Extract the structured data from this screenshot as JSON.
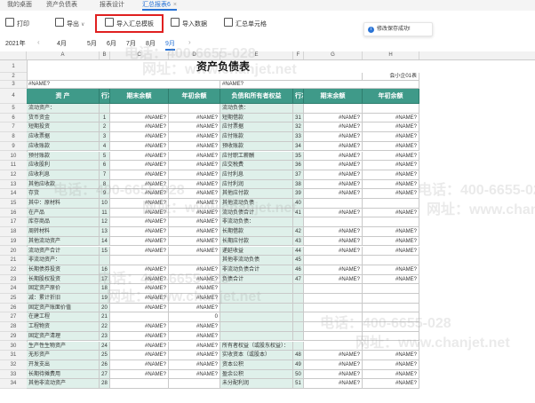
{
  "tabs": [
    {
      "label": "我的桌面"
    },
    {
      "label": "资产负债表"
    },
    {
      "label": "报表设计"
    },
    {
      "label": "汇总报表6",
      "active": true
    }
  ],
  "toolbar": {
    "print": "打印",
    "export": "导出",
    "import_template": "导入汇总模板",
    "import_data": "导入数据",
    "summary_cells": "汇总单元格"
  },
  "toast": "修改保存成功!",
  "period": {
    "year": "2021年",
    "months": [
      "4月",
      "5月",
      "6月",
      "7月",
      "8月",
      "9月"
    ],
    "active_month": "9月"
  },
  "columns": [
    "A",
    "B",
    "C",
    "D",
    "E",
    "F",
    "G",
    "H"
  ],
  "sheet": {
    "title": "资产负债表",
    "form_no": "会小企01表",
    "name_err": "#NAME?",
    "headers_left": [
      "资 产",
      "行次",
      "期末余额",
      "年初余额"
    ],
    "headers_right": [
      "负债和所有者权益",
      "行次",
      "期末余额",
      "年初余额"
    ],
    "err": "#NAME?",
    "zero": "0",
    "rows": [
      {
        "r": 5,
        "a": "流动资产：",
        "b": "",
        "cv": false,
        "e": "流动负债：",
        "f": "",
        "gv": false
      },
      {
        "r": 6,
        "a": "  货币资金",
        "b": "1",
        "cv": true,
        "e": "  短期借款",
        "f": "31",
        "gv": true
      },
      {
        "r": 7,
        "a": "  短期投资",
        "b": "2",
        "cv": true,
        "e": "  应付票据",
        "f": "32",
        "gv": true
      },
      {
        "r": 8,
        "a": "  应收票据",
        "b": "3",
        "cv": true,
        "e": "  应付账款",
        "f": "33",
        "gv": true
      },
      {
        "r": 9,
        "a": "  应收账款",
        "b": "4",
        "cv": true,
        "e": "  预收账款",
        "f": "34",
        "gv": true
      },
      {
        "r": 10,
        "a": "  预付账款",
        "b": "5",
        "cv": true,
        "e": "  应付职工薪酬",
        "f": "35",
        "gv": true
      },
      {
        "r": 11,
        "a": "  应收股利",
        "b": "6",
        "cv": true,
        "e": "  应交税费",
        "f": "36",
        "gv": true
      },
      {
        "r": 12,
        "a": "  应收利息",
        "b": "7",
        "cv": true,
        "e": "  应付利息",
        "f": "37",
        "gv": true
      },
      {
        "r": 13,
        "a": "  其他应收款",
        "b": "8",
        "cv": true,
        "e": "  应付利润",
        "f": "38",
        "gv": true
      },
      {
        "r": 14,
        "a": "  存货",
        "b": "9",
        "cv": true,
        "e": "  其他应付款",
        "f": "39",
        "gv": true
      },
      {
        "r": 15,
        "a": "    其中：原材料",
        "b": "10",
        "cv": true,
        "e": "  其他流动负债",
        "f": "40",
        "gv": false
      },
      {
        "r": 16,
        "a": "          在产品",
        "b": "11",
        "cv": true,
        "e": "    流动负债合计",
        "f": "41",
        "gv": true
      },
      {
        "r": 17,
        "a": "          库存商品",
        "b": "12",
        "cv": true,
        "e": "非流动负债：",
        "f": "",
        "gv": false
      },
      {
        "r": 18,
        "a": "          周转材料",
        "b": "13",
        "cv": true,
        "e": "  长期借款",
        "f": "42",
        "gv": true
      },
      {
        "r": 19,
        "a": "  其他流动资产",
        "b": "14",
        "cv": true,
        "e": "  长期应付款",
        "f": "43",
        "gv": true
      },
      {
        "r": 20,
        "a": "    流动资产合计",
        "b": "15",
        "cv": true,
        "e": "  递延收益",
        "f": "44",
        "gv": true
      },
      {
        "r": 21,
        "a": "非流动资产：",
        "b": "",
        "cv": false,
        "e": "  其他非流动负债",
        "f": "45",
        "gv": false
      },
      {
        "r": 22,
        "a": "  长期债券投资",
        "b": "16",
        "cv": true,
        "e": "    非流动负债合计",
        "f": "46",
        "gv": true
      },
      {
        "r": 23,
        "a": "  长期股权投资",
        "b": "17",
        "cv": true,
        "e": "      负债合计",
        "f": "47",
        "gv": true
      },
      {
        "r": 24,
        "a": "  固定资产原价",
        "b": "18",
        "cv": true,
        "e": "",
        "f": "",
        "gv": false
      },
      {
        "r": 25,
        "a": "  减：累计折旧",
        "b": "19",
        "cv": true,
        "e": "",
        "f": "",
        "gv": false
      },
      {
        "r": 26,
        "a": "  固定资产账面价值",
        "b": "20",
        "cv": true,
        "e": "",
        "f": "",
        "gv": false
      },
      {
        "r": 27,
        "a": "  在建工程",
        "b": "21",
        "cv": false,
        "e": "",
        "f": "",
        "gv": false,
        "zero": true
      },
      {
        "r": 28,
        "a": "  工程物资",
        "b": "22",
        "cv": true,
        "e": "",
        "f": "",
        "gv": false
      },
      {
        "r": 29,
        "a": "  固定资产清理",
        "b": "23",
        "cv": true,
        "e": "",
        "f": "",
        "gv": false
      },
      {
        "r": 30,
        "a": "  生产性生物资产",
        "b": "24",
        "cv": true,
        "e": "所有者权益（或股东权益）：",
        "f": "",
        "gv": false
      },
      {
        "r": 31,
        "a": "  无形资产",
        "b": "25",
        "cv": true,
        "e": "  实收资本（或股本）",
        "f": "48",
        "gv": true
      },
      {
        "r": 32,
        "a": "  开发支出",
        "b": "26",
        "cv": true,
        "e": "  资本公积",
        "f": "49",
        "gv": true
      },
      {
        "r": 33,
        "a": "  长期待摊费用",
        "b": "27",
        "cv": true,
        "e": "  盈余公积",
        "f": "50",
        "gv": true
      },
      {
        "r": 34,
        "a": "  其他非流动资产",
        "b": "28",
        "cv": false,
        "e": "  未分配利润",
        "f": "51",
        "gv": true
      }
    ]
  },
  "watermark": {
    "brand": "电话：400-6655-028",
    "site": "网址：www.chanjet.net"
  }
}
